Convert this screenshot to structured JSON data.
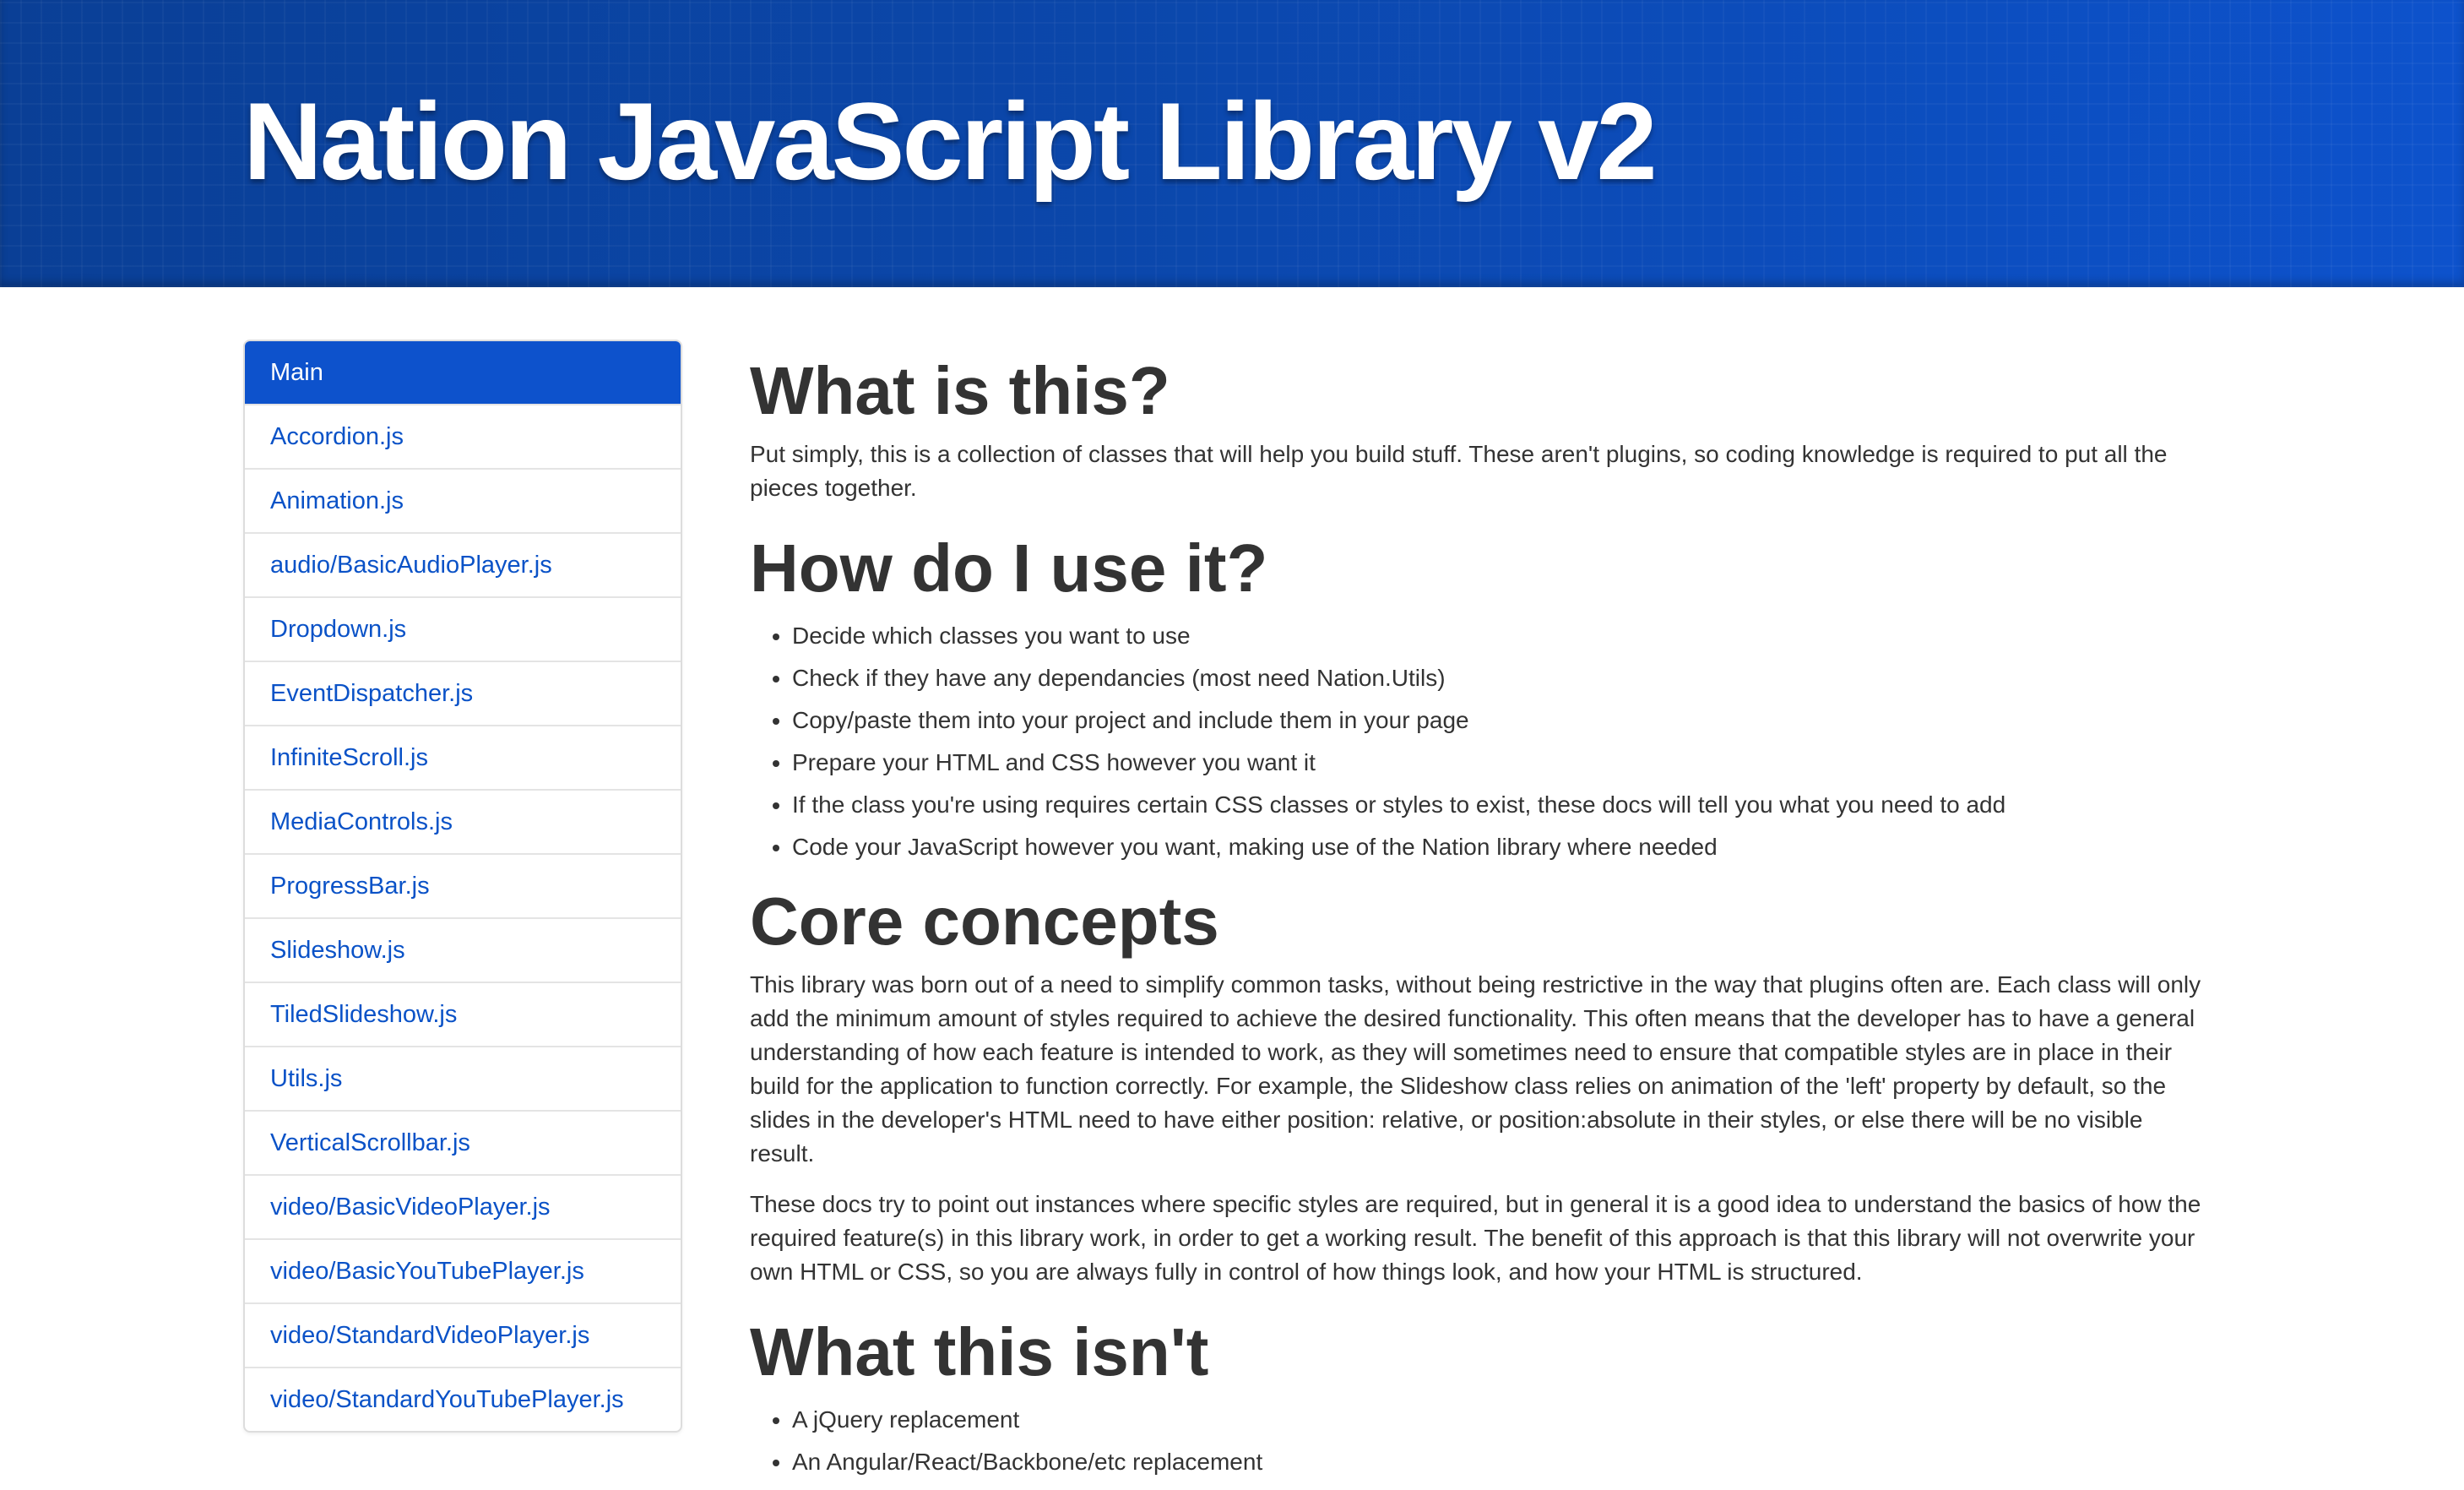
{
  "header": {
    "title": "Nation JavaScript Library v2"
  },
  "sidebar": {
    "items": [
      {
        "label": "Main",
        "active": true
      },
      {
        "label": "Accordion.js"
      },
      {
        "label": "Animation.js"
      },
      {
        "label": "audio/BasicAudioPlayer.js"
      },
      {
        "label": "Dropdown.js"
      },
      {
        "label": "EventDispatcher.js"
      },
      {
        "label": "InfiniteScroll.js"
      },
      {
        "label": "MediaControls.js"
      },
      {
        "label": "ProgressBar.js"
      },
      {
        "label": "Slideshow.js"
      },
      {
        "label": "TiledSlideshow.js"
      },
      {
        "label": "Utils.js"
      },
      {
        "label": "VerticalScrollbar.js"
      },
      {
        "label": "video/BasicVideoPlayer.js"
      },
      {
        "label": "video/BasicYouTubePlayer.js"
      },
      {
        "label": "video/StandardVideoPlayer.js"
      },
      {
        "label": "video/StandardYouTubePlayer.js"
      }
    ]
  },
  "content": {
    "what_is_this": {
      "heading": "What is this?",
      "text": "Put simply, this is a collection of classes that will help you build stuff. These aren't plugins, so coding knowledge is required to put all the pieces together."
    },
    "how_to_use": {
      "heading": "How do I use it?",
      "items": [
        "Decide which classes you want to use",
        "Check if they have any dependancies (most need Nation.Utils)",
        "Copy/paste them into your project and include them in your page",
        "Prepare your HTML and CSS however you want it",
        "If the class you're using requires certain CSS classes or styles to exist, these docs will tell you what you need to add",
        "Code your JavaScript however you want, making use of the Nation library where needed"
      ]
    },
    "core_concepts": {
      "heading": "Core concepts",
      "paragraph1": "This library was born out of a need to simplify common tasks, without being restrictive in the way that plugins often are. Each class will only add the minimum amount of styles required to achieve the desired functionality. This often means that the developer has to have a general understanding of how each feature is intended to work, as they will sometimes need to ensure that compatible styles are in place in their build for the application to function correctly. For example, the Slideshow class relies on animation of the 'left' property by default, so the slides in the developer's HTML need to have either position: relative, or position:absolute in their styles, or else there will be no visible result.",
      "paragraph2": "These docs try to point out instances where specific styles are required, but in general it is a good idea to understand the basics of how the required feature(s) in this library work, in order to get a working result. The benefit of this approach is that this library will not overwrite your own HTML or CSS, so you are always fully in control of how things look, and how your HTML is structured."
    },
    "what_this_isnt": {
      "heading": "What this isn't",
      "items": [
        "A jQuery replacement",
        "An Angular/React/Backbone/etc replacement"
      ]
    }
  }
}
